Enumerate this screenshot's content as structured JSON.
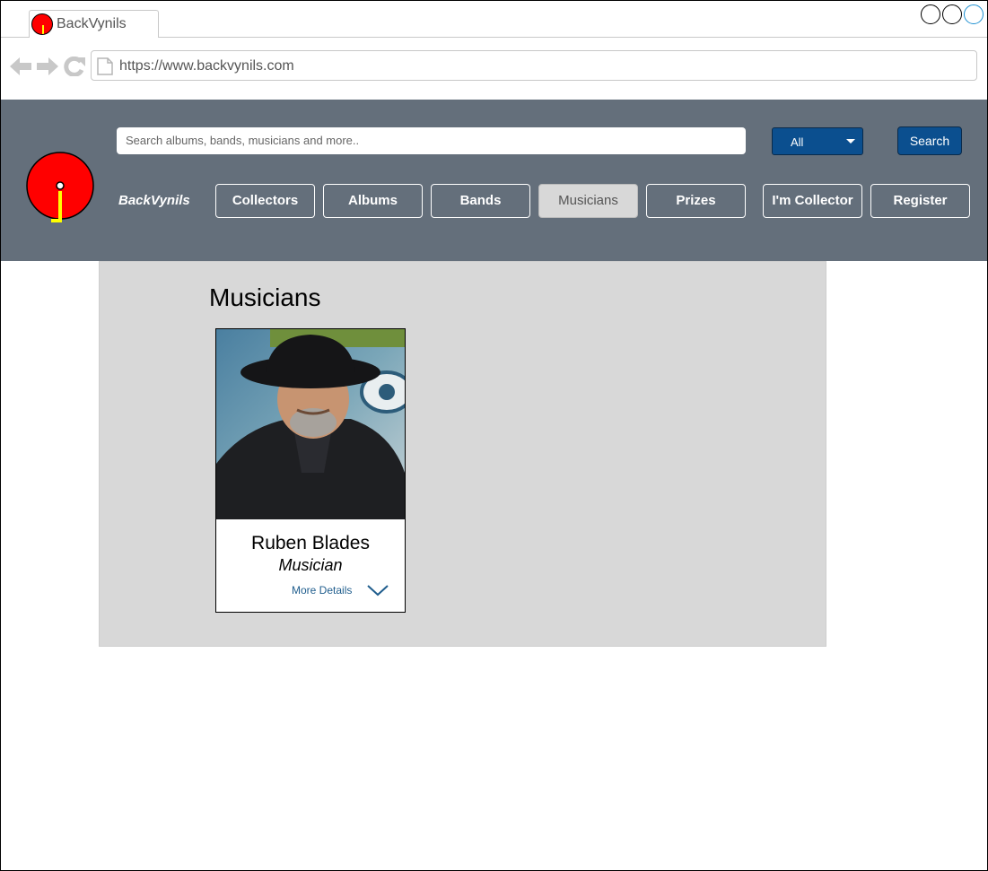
{
  "browser": {
    "tab_title": "BackVynils",
    "url": "https://www.backvynils.com"
  },
  "header": {
    "search_placeholder": "Search albums, bands, musicians and more..",
    "filter_selected": "All",
    "search_button": "Search",
    "brand": "BackVynils",
    "menu": [
      {
        "label": "Collectors",
        "active": false
      },
      {
        "label": "Albums",
        "active": false
      },
      {
        "label": "Bands",
        "active": false
      },
      {
        "label": "Musicians",
        "active": true
      },
      {
        "label": "Prizes",
        "active": false
      },
      {
        "label": "I'm Collector",
        "active": false
      },
      {
        "label": "Register",
        "active": false
      }
    ]
  },
  "main": {
    "title": "Musicians",
    "cards": [
      {
        "name": "Ruben Blades",
        "role": "Musician",
        "link": "More Details"
      }
    ]
  },
  "colors": {
    "header_bg": "#646f7b",
    "primary_button": "#0b4f8f",
    "content_bg": "#d8d8d8",
    "logo_red": "#ff0000",
    "logo_yellow": "#ffff00"
  }
}
